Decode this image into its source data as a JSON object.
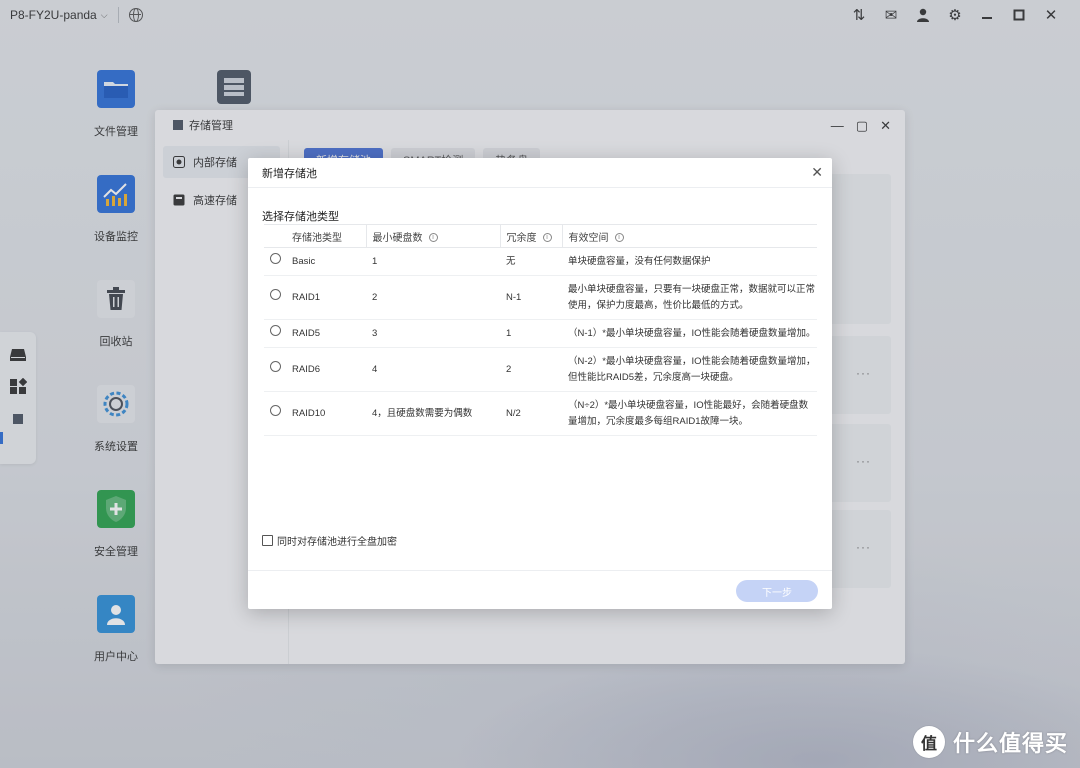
{
  "topbar": {
    "device_name": "P8-FY2U-panda",
    "icons": [
      "transfer-icon",
      "mail-icon",
      "user-icon",
      "gear-icon",
      "minimize-icon",
      "maximize-icon",
      "close-icon"
    ]
  },
  "desktop": {
    "icons": [
      {
        "label": "文件管理",
        "icon": "folder-icon",
        "color": "#2e6fd8"
      },
      {
        "label": "设备监控",
        "icon": "chart-icon",
        "color": "#2e6fd8"
      },
      {
        "label": "回收站",
        "icon": "trash-icon",
        "color": "#4a4f58"
      },
      {
        "label": "系统设置",
        "icon": "settings-icon",
        "color": "#3a8ed6"
      },
      {
        "label": "安全管理",
        "icon": "shield-icon",
        "color": "#2aa24c"
      },
      {
        "label": "用户中心",
        "icon": "user-icon",
        "color": "#2e8fd8"
      }
    ]
  },
  "window": {
    "title": "存储管理",
    "sidebar": [
      {
        "label": "内部存储",
        "active": true
      },
      {
        "label": "高速存储",
        "active": false
      }
    ],
    "tabs": [
      "新增存储池",
      "SMART检测",
      "热备盘"
    ]
  },
  "dialog": {
    "title": "新增存储池",
    "section_title": "选择存储池类型",
    "columns": [
      "存储池类型",
      "最小硬盘数",
      "冗余度",
      "有效空间"
    ],
    "rows": [
      {
        "type": "Basic",
        "min_disks": "1",
        "redundancy": "无",
        "space": "单块硬盘容量，没有任何数据保护"
      },
      {
        "type": "RAID1",
        "min_disks": "2",
        "redundancy": "N-1",
        "space": "最小单块硬盘容量，只要有一块硬盘正常，数据就可以正常使用，保护力度最高，性价比最低的方式。"
      },
      {
        "type": "RAID5",
        "min_disks": "3",
        "redundancy": "1",
        "space": "（N-1）*最小单块硬盘容量，IO性能会随着硬盘数量增加。"
      },
      {
        "type": "RAID6",
        "min_disks": "4",
        "redundancy": "2",
        "space": "（N-2）*最小单块硬盘容量，IO性能会随着硬盘数量增加，但性能比RAID5差，冗余度高一块硬盘。"
      },
      {
        "type": "RAID10",
        "min_disks": "4，且硬盘数需要为偶数",
        "redundancy": "N/2",
        "space": "（N÷2）*最小单块硬盘容量，IO性能最好，会随着硬盘数量增加，冗余度最多每组RAID1故障一块。"
      }
    ],
    "encrypt_label": "同时对存储池进行全盘加密",
    "encrypt_checked": false,
    "next_button": "下一步"
  },
  "watermark": {
    "badge": "值",
    "text": "什么值得买"
  }
}
